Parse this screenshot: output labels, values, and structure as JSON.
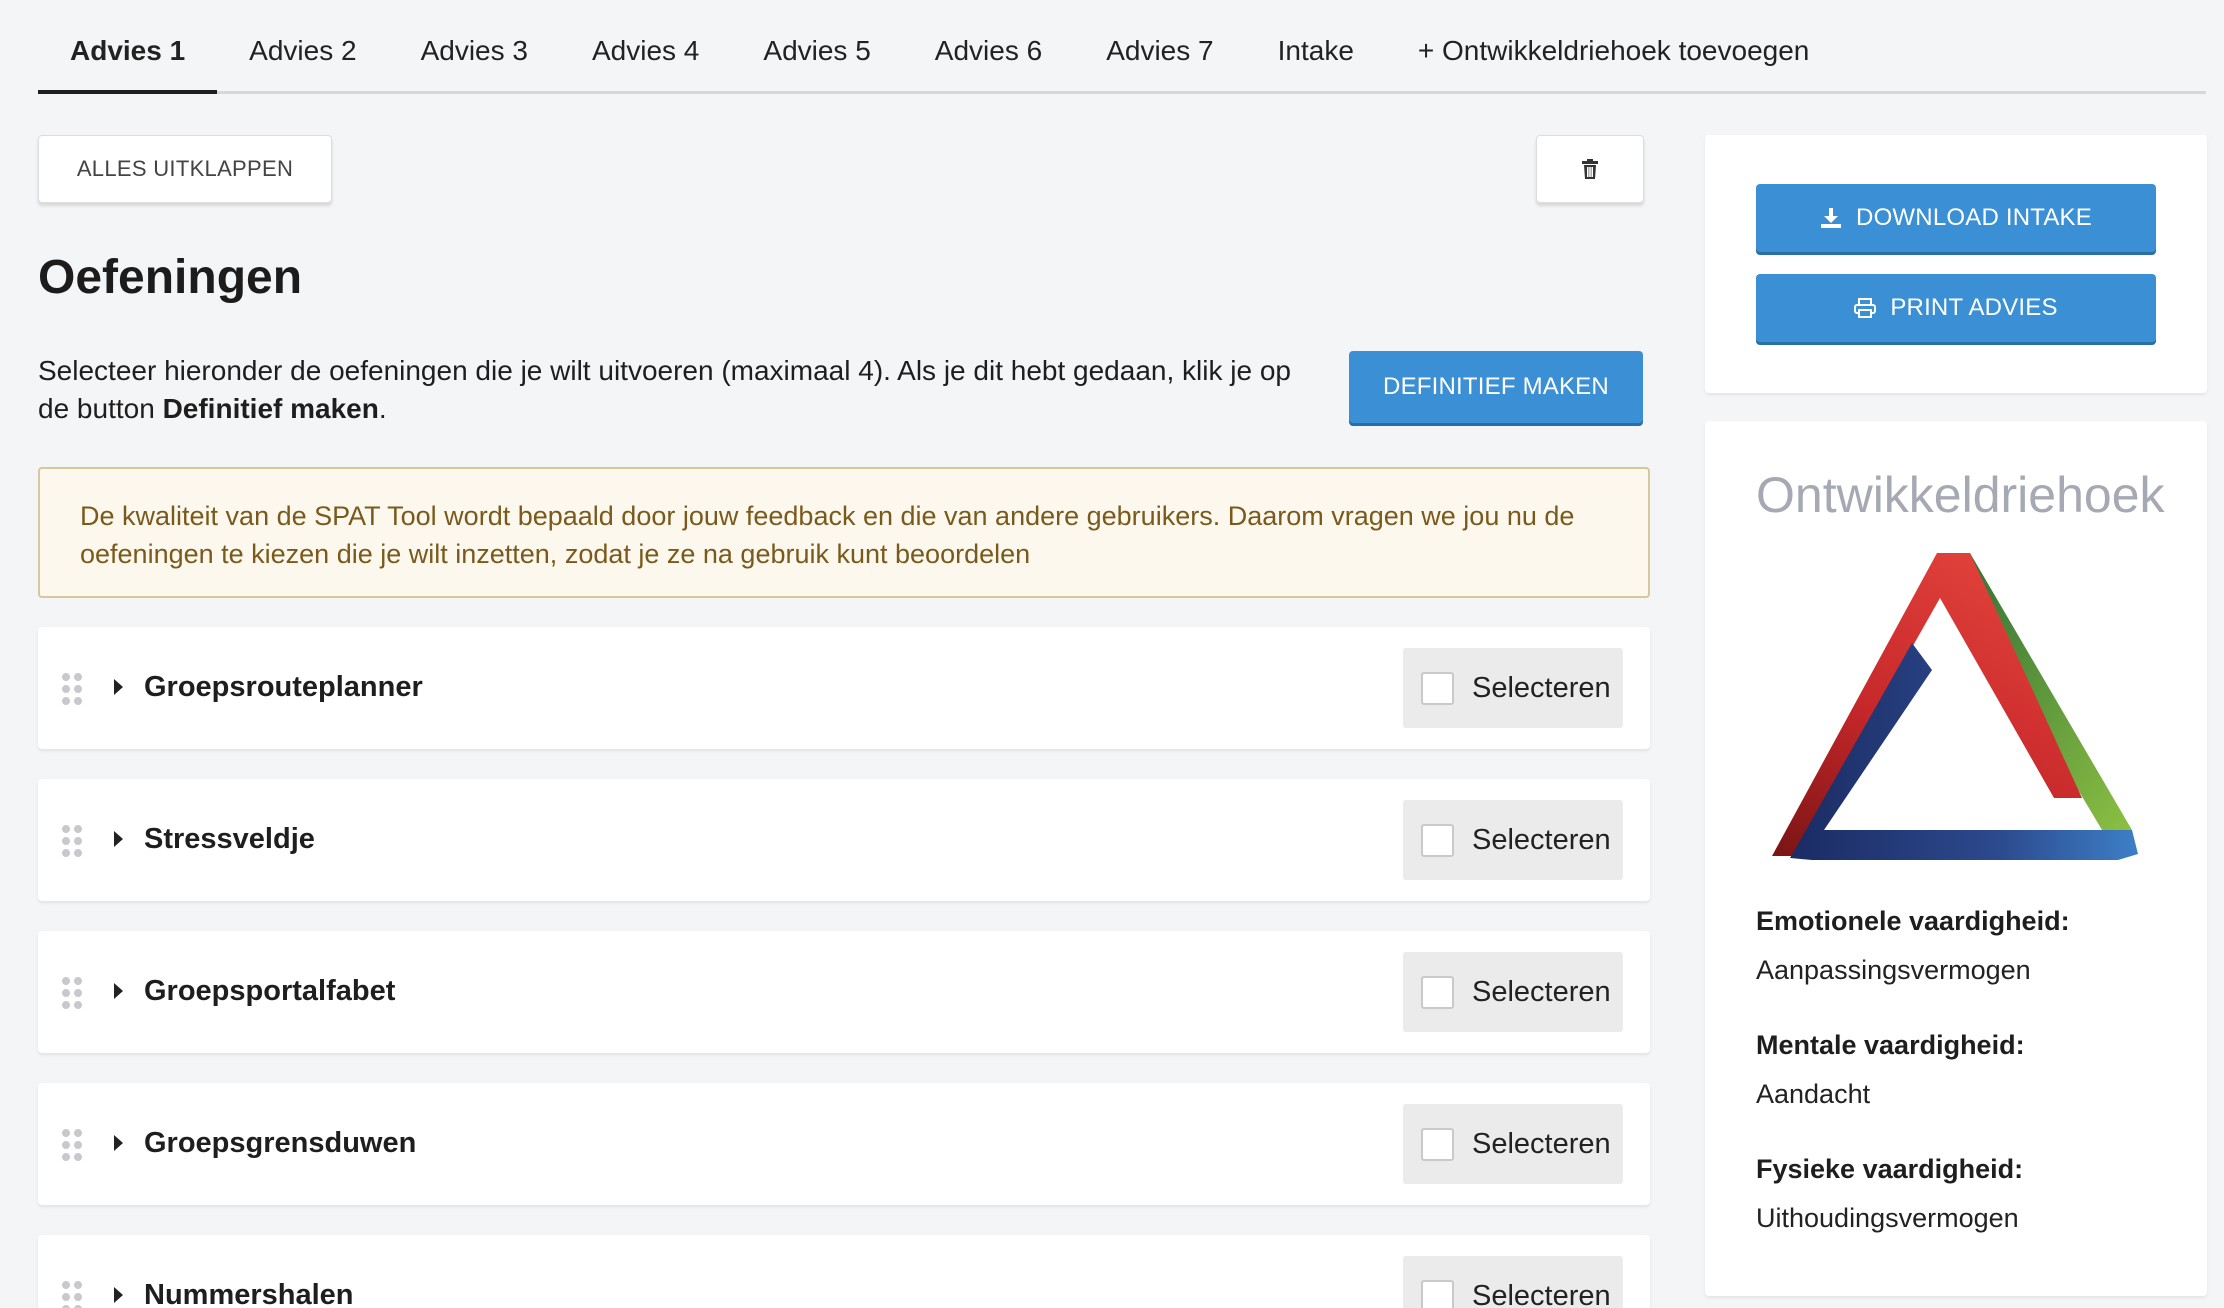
{
  "tabs": [
    {
      "label": "Advies 1",
      "active": true
    },
    {
      "label": "Advies 2"
    },
    {
      "label": "Advies 3"
    },
    {
      "label": "Advies 4"
    },
    {
      "label": "Advies 5"
    },
    {
      "label": "Advies 6"
    },
    {
      "label": "Advies 7"
    },
    {
      "label": "Intake"
    },
    {
      "label": "+ Ontwikkeldriehoek toevoegen"
    }
  ],
  "toolbar": {
    "expand_label": "ALLES UITKLAPPEN",
    "trash_icon": "trash-icon"
  },
  "main": {
    "title": "Oefeningen",
    "intro_text": "Selecteer hieronder de oefeningen die je wilt uitvoeren (maximaal 4). Als je dit hebt gedaan, klik je op de button ",
    "intro_bold": "Definitief maken",
    "intro_end": ".",
    "definitive_label": "DEFINITIEF MAKEN",
    "notice": "De kwaliteit van de SPAT Tool wordt bepaald door jouw feedback en die van andere gebruikers. Daarom vragen we jou nu de oefeningen te kiezen die je wilt inzetten, zodat je ze na gebruik kunt beoordelen"
  },
  "exercises": [
    {
      "title": "Groepsrouteplanner",
      "select_label": "Selecteren",
      "checked": false
    },
    {
      "title": "Stressveldje",
      "select_label": "Selecteren",
      "checked": false
    },
    {
      "title": "Groepsportalfabet",
      "select_label": "Selecteren",
      "checked": false
    },
    {
      "title": "Groepsgrensduwen",
      "select_label": "Selecteren",
      "checked": false
    },
    {
      "title": "Nummershalen",
      "select_label": "Selecteren",
      "checked": false
    }
  ],
  "sidebar": {
    "download_label": "DOWNLOAD INTAKE",
    "download_icon": "download-icon",
    "print_label": "PRINT ADVIES",
    "print_icon": "printer-icon",
    "triangle_title": "Ontwikkeldriehoek",
    "skills": [
      {
        "label": "Emotionele vaardigheid:",
        "value": "Aanpassingsvermogen"
      },
      {
        "label": "Mentale vaardigheid:",
        "value": "Aandacht"
      },
      {
        "label": "Fysieke vaardigheid:",
        "value": "Uithoudingsvermogen"
      }
    ]
  },
  "colors": {
    "primary": "#3b8fd4",
    "notice_bg": "#fdf8ee",
    "notice_text": "#7a5a1c",
    "triangle_red": "#d2332f",
    "triangle_green": "#3f8b3a",
    "triangle_blue": "#2f4e94"
  }
}
